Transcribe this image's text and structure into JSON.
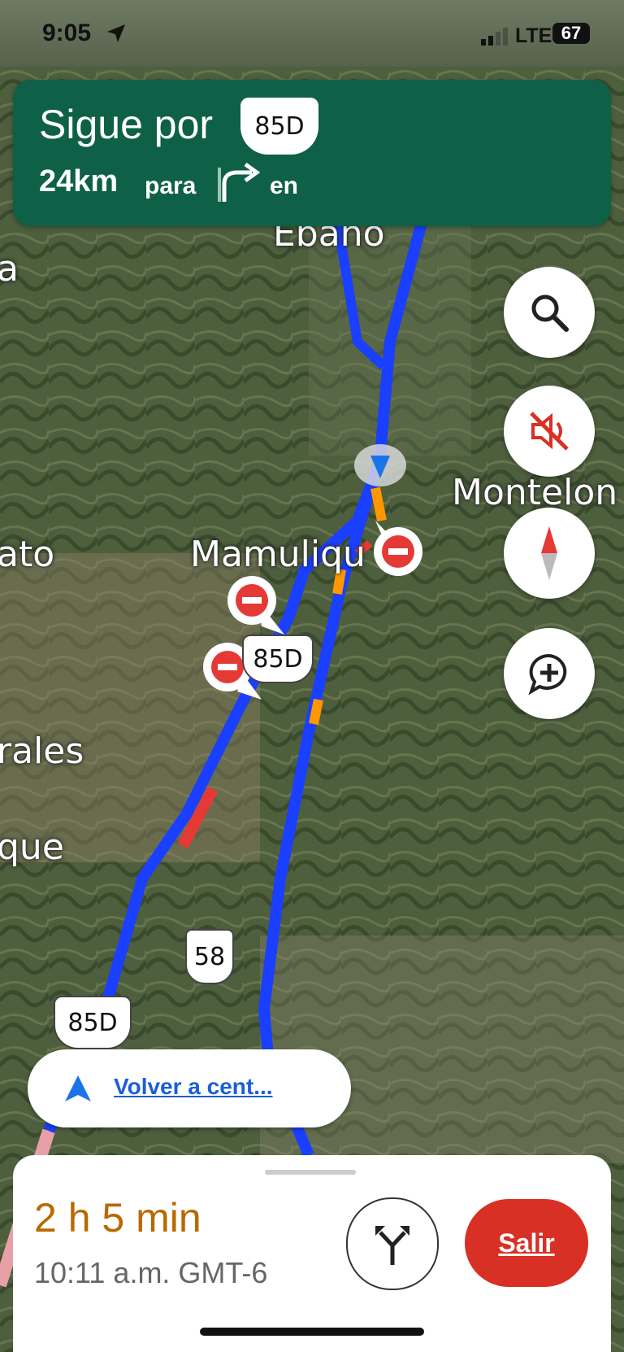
{
  "status_bar": {
    "time": "9:05",
    "network": "LTE",
    "battery": "67"
  },
  "instruction": {
    "line1_prefix": "Sigue por",
    "route_shield": "85D",
    "distance": "24km",
    "para": "para",
    "suffix": "en"
  },
  "map_labels": {
    "ebano": "Ebano",
    "montelon": "Montelon",
    "mamuliqu": "Mamuliqu",
    "ato": "ato",
    "rales": "rales",
    "que": "que",
    "a": "a"
  },
  "shields": {
    "s1": "85D",
    "s2": "58",
    "s3": "85D"
  },
  "recenter": {
    "label": "Volver a cent..."
  },
  "trip": {
    "duration": "2 h 5 min",
    "eta": "10:11 a.m. GMT-6",
    "exit_label": "Salir"
  },
  "colors": {
    "banner": "#0e6146",
    "route": "#1a3fff",
    "duration": "#b86a00",
    "exit": "#d93025"
  },
  "icons": [
    "navigation-arrow-icon",
    "signal-icon",
    "battery-icon",
    "turn-right-icon",
    "search-icon",
    "mute-icon",
    "compass-icon",
    "add-report-icon",
    "closure-icon",
    "recenter-arrow-icon",
    "alternate-routes-icon"
  ]
}
